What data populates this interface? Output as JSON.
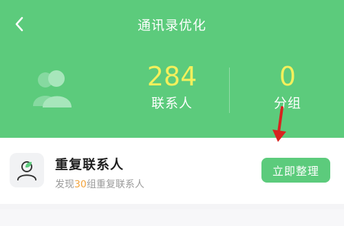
{
  "header": {
    "title": "通讯录优化",
    "back_icon": "chevron-left-icon",
    "bg_color": "#5ccb7c"
  },
  "stats": {
    "contacts": {
      "value": "284",
      "label": "联系人"
    },
    "groups": {
      "value": "0",
      "label": "分组"
    },
    "value_color": "#f3f05c"
  },
  "card": {
    "title": "重复联系人",
    "subtitle_prefix": "发现",
    "subtitle_count": "30",
    "subtitle_suffix": "组重复联系人",
    "button_label": "立即整理",
    "icon": "contact-leaf-icon",
    "count_color": "#f2a23a"
  }
}
